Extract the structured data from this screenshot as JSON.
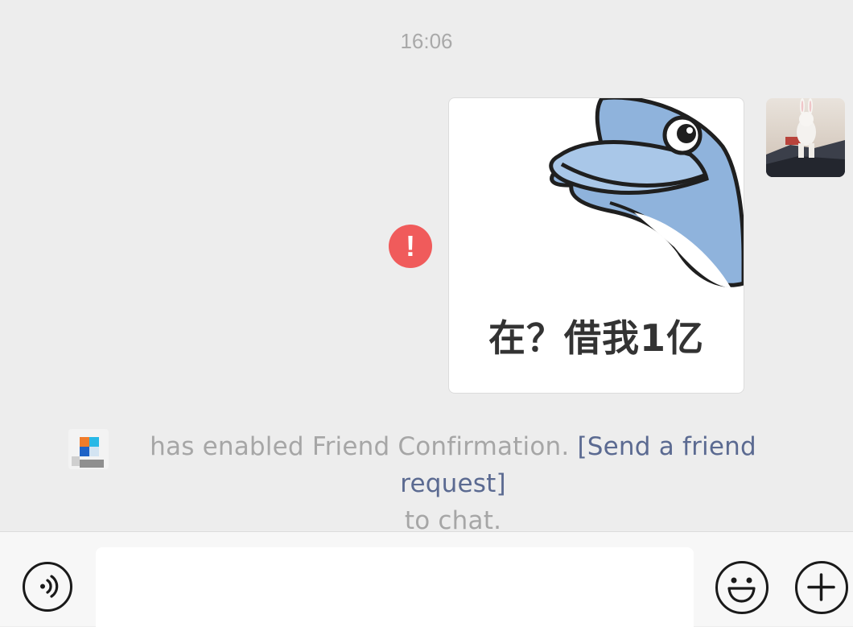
{
  "chat": {
    "timestamp": "16:06",
    "sticker": {
      "caption": "在？借我1亿"
    },
    "error_badge": "!",
    "system_notice": {
      "text": "has enabled Friend Confirmation.",
      "link": "[Send a friend request]",
      "suffix": "to chat."
    }
  },
  "input_bar": {
    "message_value": "",
    "icons": [
      "voice-icon",
      "emoji-icon",
      "plus-icon"
    ]
  },
  "colors": {
    "background": "#ededed",
    "error": "#f05b5b",
    "link": "#5b6a91",
    "notice_text": "#a6a6a6"
  }
}
